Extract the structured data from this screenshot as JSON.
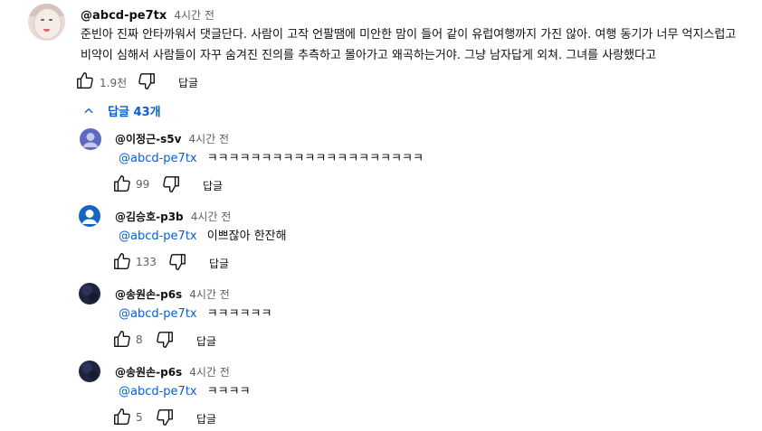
{
  "comment": {
    "author": "@abcd-pe7tx",
    "time": "4시간 전",
    "text_line1": "준빈아 진짜 안타까워서 댓글단다. 사람이 고작 언팔땜에 미안한 맘이 들어 같이 유럽여행까지 가진 않아. 여행 동기가 너무 억지스럽고",
    "text_line2": "비약이 심해서 사람들이 자꾸 숨겨진 진의를 추측하고 몰아가고 왜곡하는거야. 그냥 남자답게 외쳐. 그녀를 사랑했다고",
    "likes": "1.9천",
    "reply_label": "답글",
    "replies_toggle": "답글 43개"
  },
  "replies": [
    {
      "author": "@이정근-s5v",
      "time": "4시간 전",
      "mention": "@abcd-pe7tx",
      "text": "ㅋㅋㅋㅋㅋㅋㅋㅋㅋㅋㅋㅋㅋㅋㅋㅋㅋㅋㅋㅋ",
      "likes": "99",
      "reply_label": "답글",
      "avatar_color": "#5c6bc0"
    },
    {
      "author": "@김승호-p3b",
      "time": "4시간 전",
      "mention": "@abcd-pe7tx",
      "text": "이쁘잖아 한잔해",
      "likes": "133",
      "reply_label": "답글",
      "avatar_color": "#1565c0"
    },
    {
      "author": "@송원손-p6s",
      "time": "4시간 전",
      "mention": "@abcd-pe7tx",
      "text": "ㅋㅋㅋㅋㅋㅋ",
      "likes": "8",
      "reply_label": "답글",
      "avatar_color": "#1f2340"
    },
    {
      "author": "@송원손-p6s",
      "time": "4시간 전",
      "mention": "@abcd-pe7tx",
      "text": "ㅋㅋㅋㅋ",
      "likes": "5",
      "reply_label": "답글",
      "avatar_color": "#1f2340"
    }
  ],
  "icons": {
    "like": "thumbs-up-icon",
    "dislike": "thumbs-down-icon",
    "toggle": "chevron-up-icon"
  }
}
